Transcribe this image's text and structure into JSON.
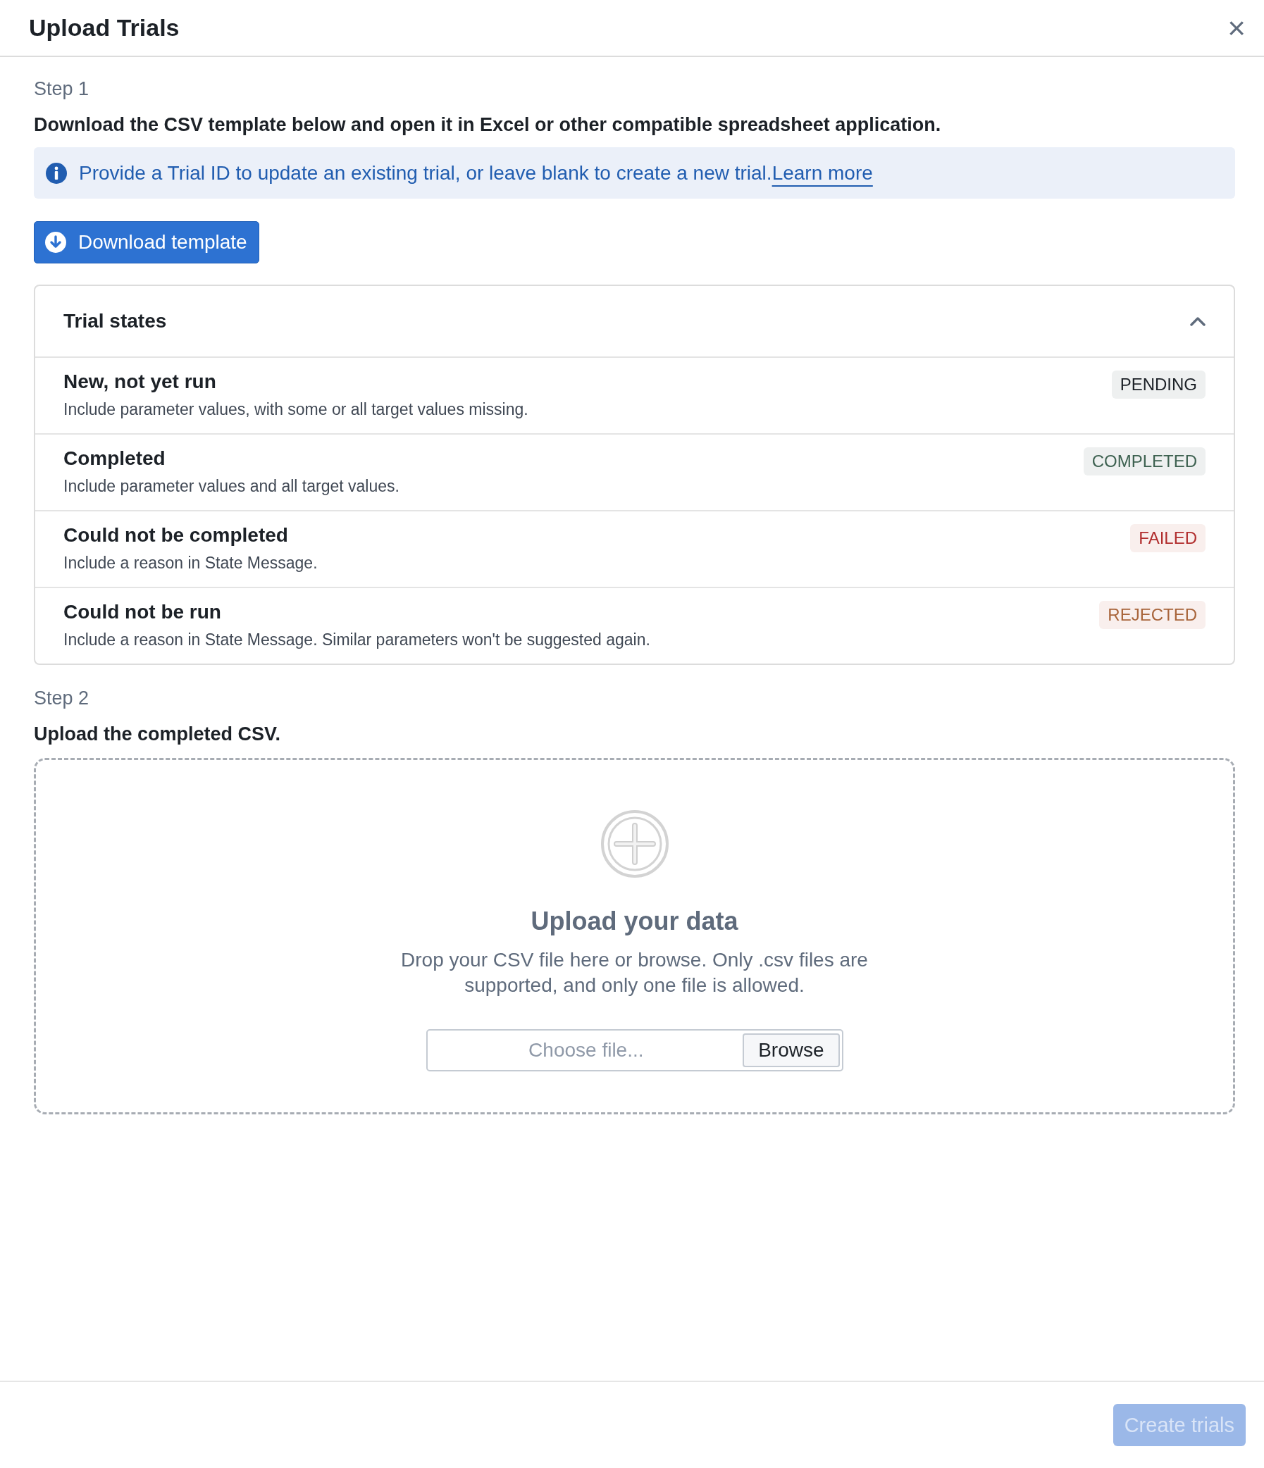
{
  "dialog": {
    "title": "Upload Trials",
    "close": "×"
  },
  "step1": {
    "label": "Step 1",
    "instruction": "Download the CSV template below and open it in Excel or other compatible spreadsheet application.",
    "info": {
      "text": "Provide a Trial ID to update an existing trial, or leave blank to create a new trial.",
      "link": "Learn more"
    },
    "download_button": "Download template"
  },
  "trial_states": {
    "title": "Trial states",
    "expanded": true,
    "rows": [
      {
        "title": "New, not yet run",
        "description": "Include parameter values, with some or all target values missing.",
        "badge": "PENDING",
        "kind": "neutral"
      },
      {
        "title": "Completed",
        "description": "Include parameter values and all target values.",
        "badge": "COMPLETED",
        "kind": "success"
      },
      {
        "title": "Could not be completed",
        "description": "Include a reason in State Message.",
        "badge": "FAILED",
        "kind": "danger"
      },
      {
        "title": "Could not be run",
        "description": "Include a reason in State Message. Similar parameters won't be suggested again.",
        "badge": "REJECTED",
        "kind": "warning"
      }
    ]
  },
  "step2": {
    "label": "Step 2",
    "instruction": "Upload the completed CSV.",
    "dropzone": {
      "title": "Upload your data",
      "text": "Drop your CSV file here or browse. Only .csv files are supported, and only one file is allowed.",
      "file_field": {
        "placeholder": "Choose file...",
        "button": "Browse"
      }
    }
  },
  "footer": {
    "create_button": {
      "label": "Create trials",
      "disabled": true
    }
  }
}
